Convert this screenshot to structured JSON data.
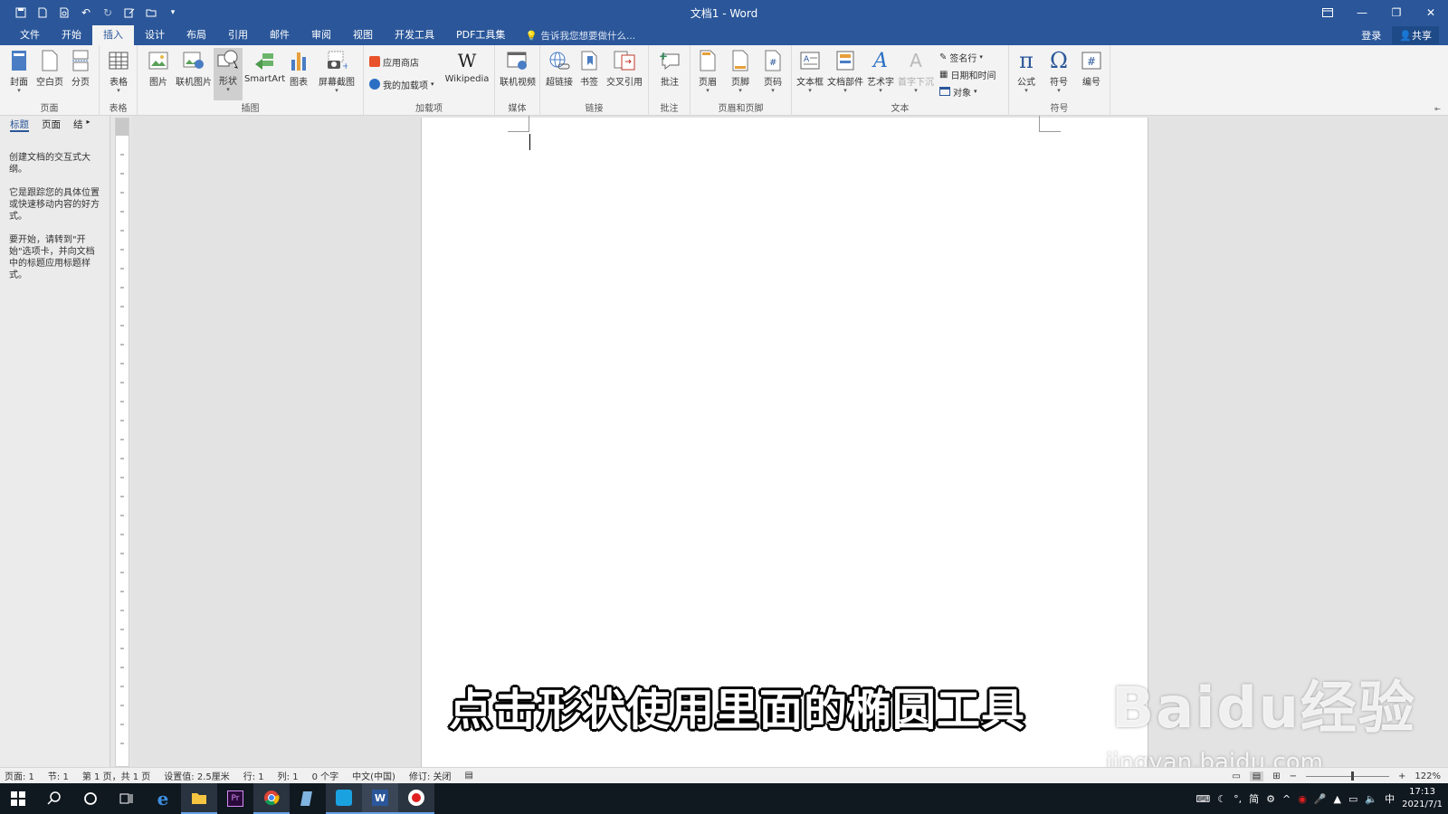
{
  "window": {
    "title": "文档1 - Word"
  },
  "quick_access": [
    "save-icon",
    "new-doc-icon",
    "print-preview-icon",
    "undo-icon",
    "redo-icon",
    "edit-icon",
    "open-icon",
    "customize-icon"
  ],
  "tabs": [
    {
      "label": "文件",
      "active": false
    },
    {
      "label": "开始",
      "active": false
    },
    {
      "label": "插入",
      "active": true
    },
    {
      "label": "设计",
      "active": false
    },
    {
      "label": "布局",
      "active": false
    },
    {
      "label": "引用",
      "active": false
    },
    {
      "label": "邮件",
      "active": false
    },
    {
      "label": "审阅",
      "active": false
    },
    {
      "label": "视图",
      "active": false
    },
    {
      "label": "开发工具",
      "active": false
    },
    {
      "label": "PDF工具集",
      "active": false
    }
  ],
  "tellme": "告诉我您想要做什么...",
  "account": {
    "login": "登录",
    "share": "共享"
  },
  "ribbon": {
    "groups": {
      "pages": "页面",
      "tables": "表格",
      "illustrations": "插图",
      "addins": "加载项",
      "media": "媒体",
      "links": "链接",
      "comments": "批注",
      "header_footer": "页眉和页脚",
      "text": "文本",
      "symbols": "符号"
    },
    "buttons": {
      "cover": "封面",
      "blank": "空白页",
      "pagebreak": "分页",
      "table": "表格",
      "picture": "图片",
      "online_picture": "联机图片",
      "shapes": "形状",
      "smartart": "SmartArt",
      "chart": "图表",
      "screenshot": "屏幕截图",
      "store": "应用商店",
      "myaddins": "我的加载项",
      "wikipedia": "Wikipedia",
      "online_video": "联机视频",
      "hyperlink": "超链接",
      "bookmark": "书签",
      "crossref": "交叉引用",
      "comment": "批注",
      "header": "页眉",
      "footer": "页脚",
      "pagenum": "页码",
      "textbox": "文本框",
      "quickparts": "文档部件",
      "wordart": "艺术字",
      "dropcap": "首字下沉",
      "signature": "签名行",
      "datetime": "日期和时间",
      "object": "对象",
      "equation": "公式",
      "symbol": "符号",
      "numbering": "编号"
    }
  },
  "navpane": {
    "tabs": [
      "标题",
      "页面",
      "结"
    ],
    "paragraphs": [
      "创建文档的交互式大纲。",
      "它是跟踪您的具体位置或快速移动内容的好方式。",
      "要开始，请转到\"开始\"选项卡，并向文档中的标题应用标题样式。"
    ]
  },
  "caption": "点击形状使用里面的椭圆工具",
  "watermark": {
    "brand": "Baidu经验",
    "url": "jingyan.baidu.com"
  },
  "statusbar": {
    "items": [
      "页面: 1",
      "节: 1",
      "第 1 页，共 1 页",
      "设置值: 2.5厘米",
      "行: 1",
      "列: 1",
      "0 个字",
      "中文(中国)",
      "修订: 关闭"
    ],
    "zoom": "122%"
  },
  "taskbar": {
    "apps": [
      "start-icon",
      "search-icon",
      "cortana-icon",
      "taskview-icon",
      "edge-icon",
      "explorer-icon",
      "premiere-icon",
      "chrome-icon",
      "notes-icon",
      "app-icon",
      "word-icon",
      "recorder-icon"
    ],
    "ime": "简",
    "lang": "中",
    "time": "17:13",
    "date": "2021/7/1"
  }
}
